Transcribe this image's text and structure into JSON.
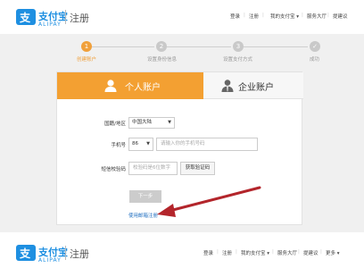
{
  "header": {
    "logo_glyph": "支",
    "logo_cn": "支付宝",
    "logo_en": "ALIPAY",
    "logo_sub": "注册",
    "nav": [
      "登录",
      "注册",
      "我的支付宝 ▾",
      "服务大厅",
      "提建议"
    ]
  },
  "steps": [
    {
      "num": "1",
      "label": "创建账户"
    },
    {
      "num": "2",
      "label": "设置身份信息"
    },
    {
      "num": "3",
      "label": "设置支付方式"
    },
    {
      "num": "✓",
      "label": "成功"
    }
  ],
  "tabs": {
    "personal": "个人账户",
    "enterprise": "企业账户"
  },
  "form": {
    "country_label": "国籍/地区",
    "country_value": "中国大陆",
    "phone_label": "手机号",
    "phone_code": "86",
    "phone_placeholder": "请输入你的手机号码",
    "sms_label": "短信校验码",
    "sms_placeholder": "校验码是6位数字",
    "get_code": "获取验证码",
    "next": "下一步",
    "email_link": "使用邮箱注册"
  },
  "footer": {
    "logo_glyph": "支",
    "logo_cn": "支付宝",
    "logo_en": "ALIPAY",
    "logo_sub": "注册",
    "nav": [
      "登录",
      "注册",
      "我的支付宝 ▾",
      "服务大厅",
      "提建议",
      "更多 ▾"
    ]
  },
  "colors": {
    "brand": "#1e8fe1",
    "active": "#f3a032",
    "annotation_arrow": "#b3252b"
  }
}
